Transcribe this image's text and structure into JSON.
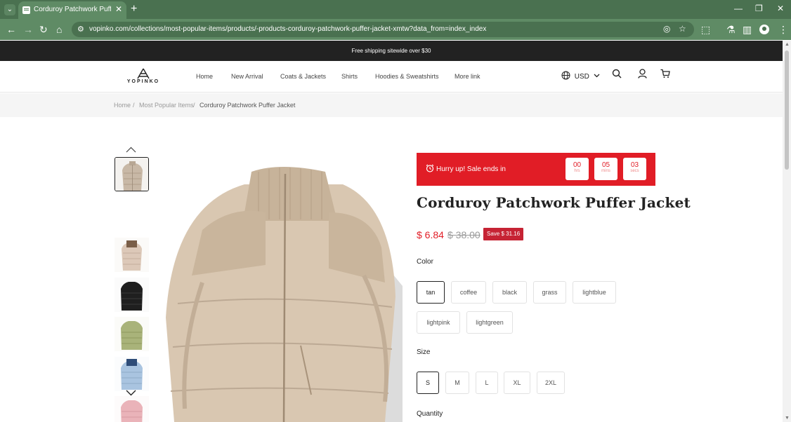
{
  "browser": {
    "tab_title": "Corduroy Patchwork Puffer Jacket",
    "url": "vopinko.com/collections/most-popular-items/products/-products-corduroy-patchwork-puffer-jacket-xmtw?data_from=index_index"
  },
  "announcement": "Free shipping sitewide over $30",
  "header": {
    "logo_text": "YOPINKO",
    "nav": [
      "Home",
      "New Arrival",
      "Coats & Jackets",
      "Shirts",
      "Hoodies & Sweatshirts",
      "More link"
    ],
    "currency": "USD"
  },
  "breadcrumb": {
    "home": "Home",
    "sep": "/",
    "collection": "Most Popular Items",
    "current": "Corduroy Patchwork Puffer Jacket"
  },
  "gallery": {
    "thumb_colors": [
      "tan",
      "coffee",
      "black",
      "grass",
      "lightblue",
      "lightpink"
    ]
  },
  "sale": {
    "text": "Hurry up!  Sale ends in",
    "countdown": [
      {
        "value": "00",
        "unit": "hrs"
      },
      {
        "value": "05",
        "unit": "mins"
      },
      {
        "value": "03",
        "unit": "secs"
      }
    ]
  },
  "product": {
    "title": "Corduroy Patchwork Puffer Jacket",
    "price": "$ 6.84",
    "compare_price": "$ 38.00",
    "save_badge": "Save $ 31.16",
    "color_label": "Color",
    "colors": [
      "tan",
      "coffee",
      "black",
      "grass",
      "lightblue",
      "lightpink",
      "lightgreen"
    ],
    "selected_color": "tan",
    "size_label": "Size",
    "sizes": [
      "S",
      "M",
      "L",
      "XL",
      "2XL"
    ],
    "selected_size": "S",
    "quantity_label": "Quantity"
  }
}
